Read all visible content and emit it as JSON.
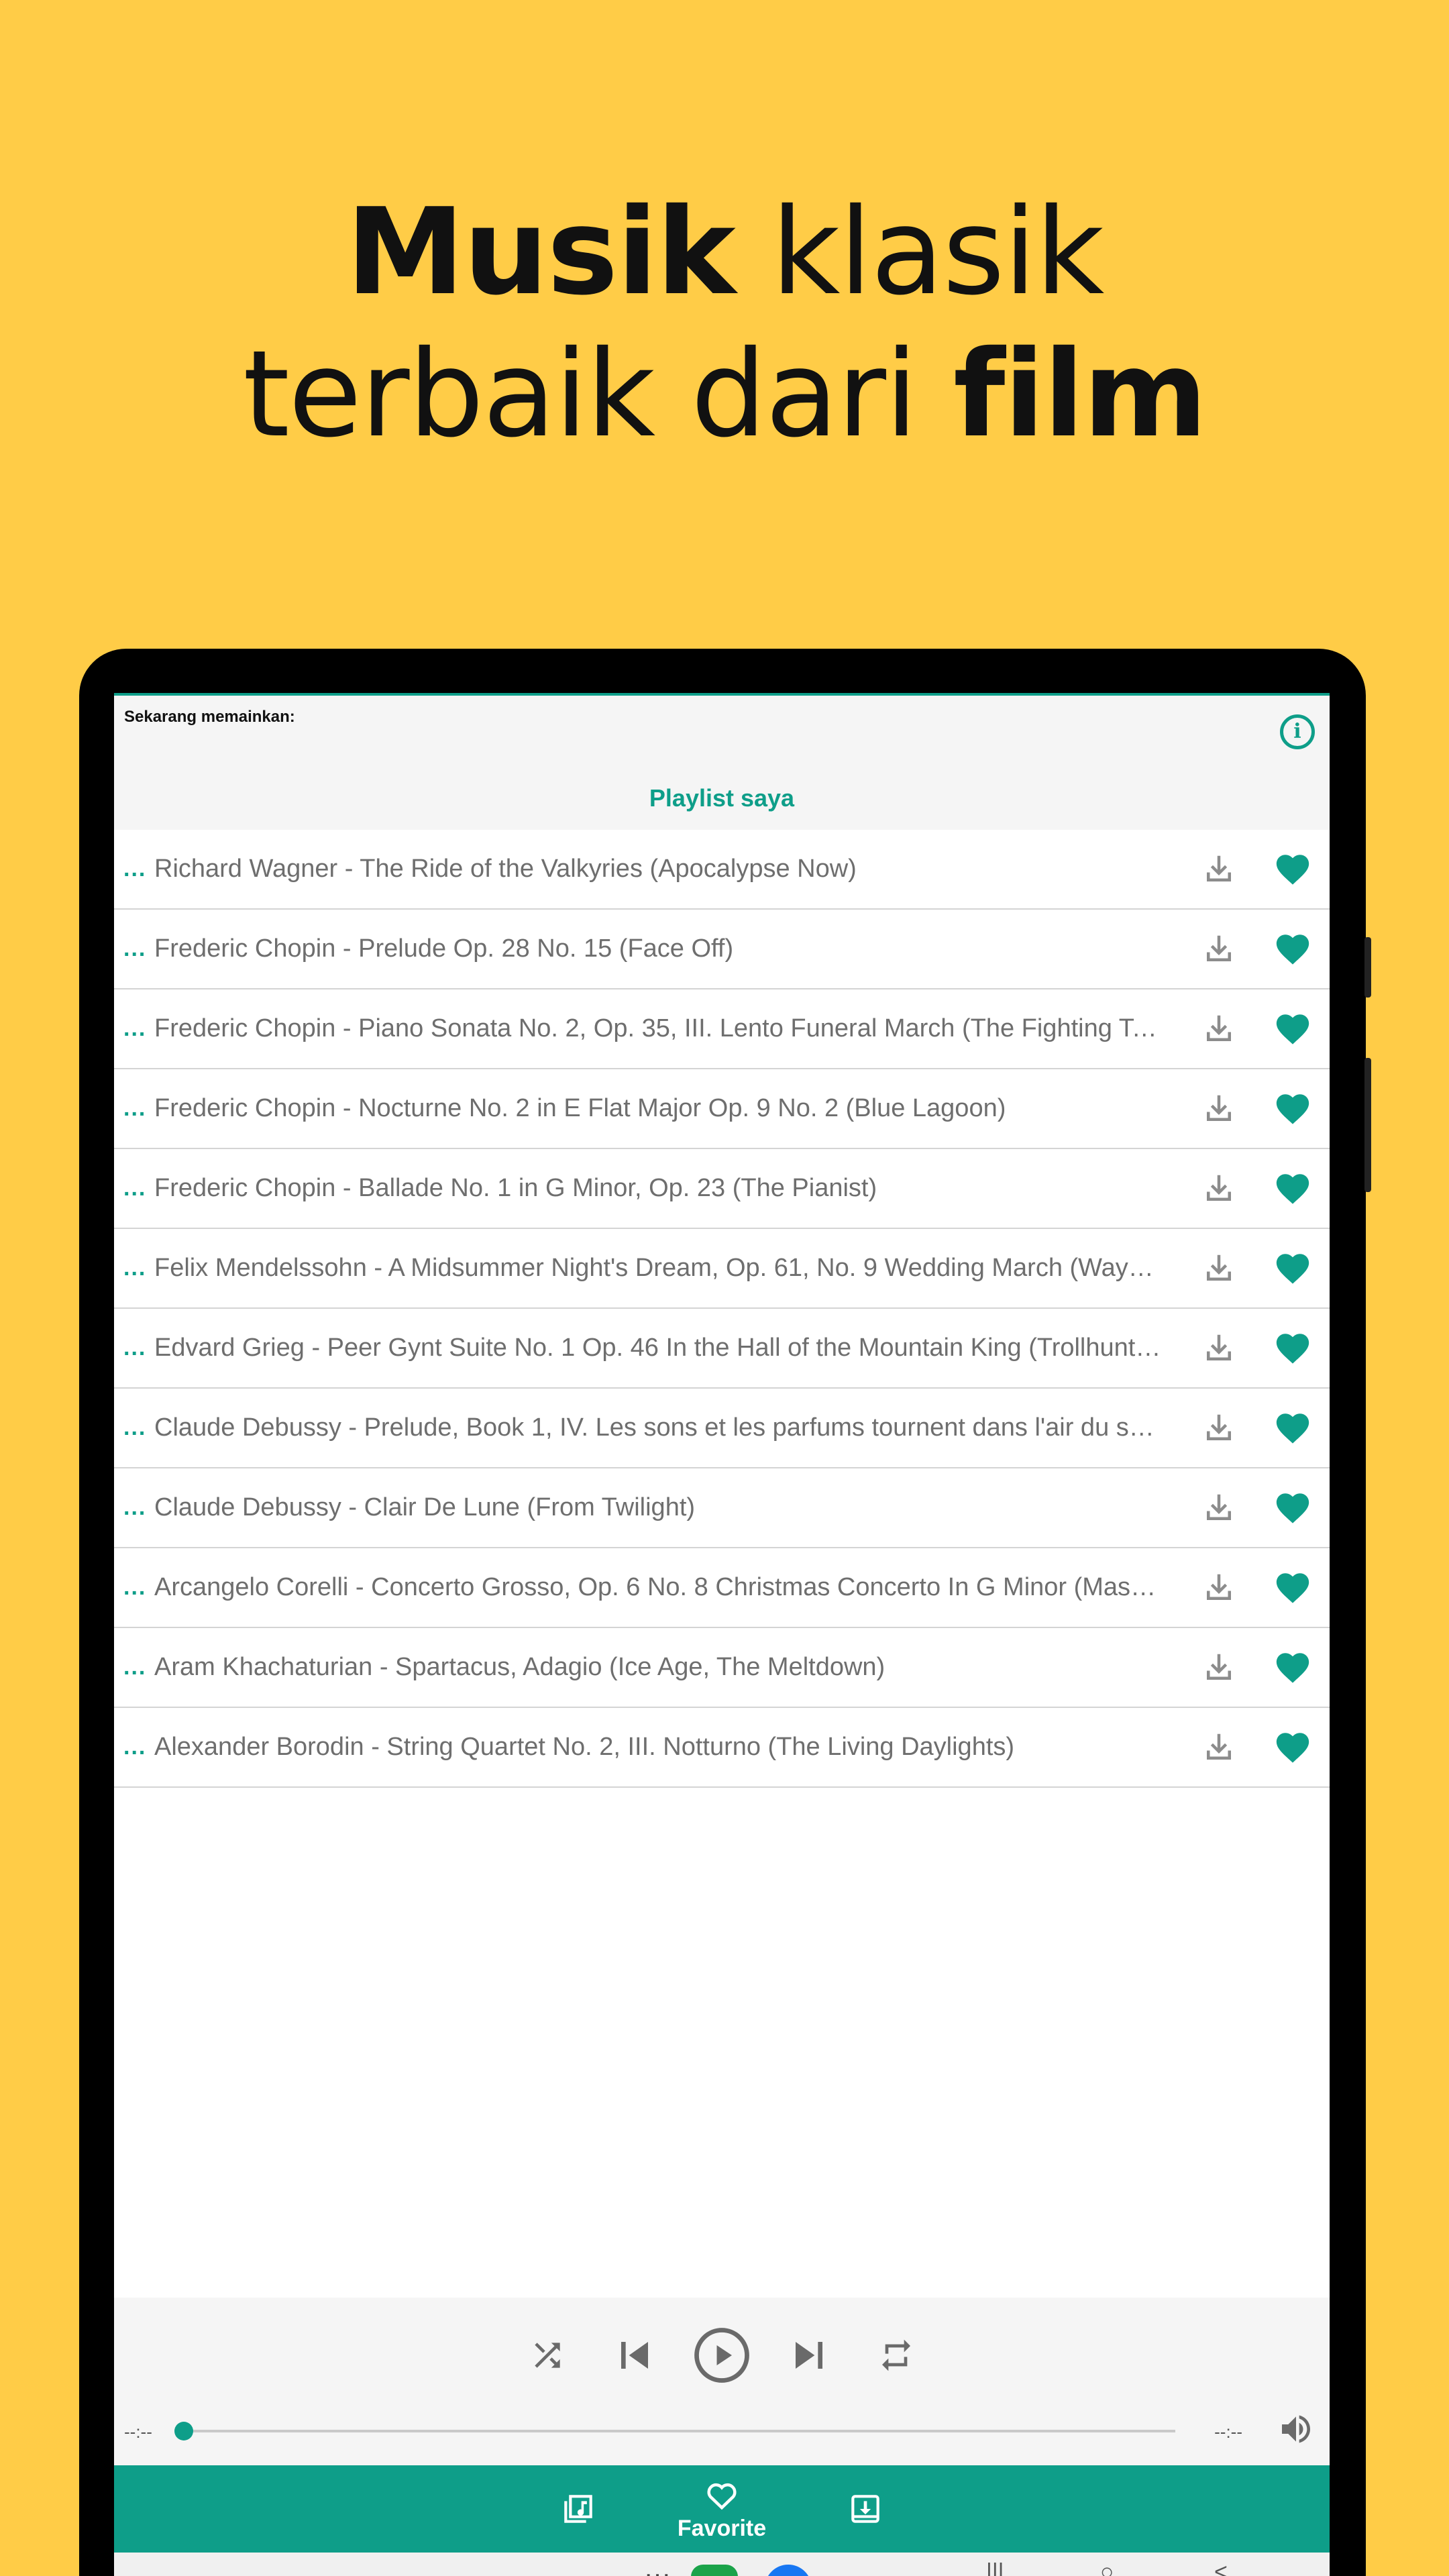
{
  "headline": {
    "line1_bold": "Musik",
    "line1_rest": " klasik",
    "line2_rest": "terbaik dari ",
    "line2_bold": "film"
  },
  "app": {
    "now_playing_label": "Sekarang memainkan:",
    "playlist_title": "Playlist saya",
    "accent_color": "#0E9E89",
    "tracks": [
      {
        "dots": "...",
        "title": "Richard Wagner - The Ride of the Valkyries (Apocalypse Now)"
      },
      {
        "dots": "...",
        "title": "Frederic Chopin - Prelude Op. 28 No. 15 (Face Off)"
      },
      {
        "dots": "...",
        "title": "Frederic Chopin - Piano Sonata No. 2, Op. 35, III. Lento Funeral March (The Fighting Tempt.."
      },
      {
        "dots": "...",
        "title": "Frederic Chopin - Nocturne No. 2 in E Flat Major Op. 9 No. 2 (Blue Lagoon)"
      },
      {
        "dots": "...",
        "title": "Frederic Chopin - Ballade No. 1 in G Minor, Op. 23 (The Pianist)"
      },
      {
        "dots": "...",
        "title": "Felix Mendelssohn - A Midsummer Night's Dream, Op. 61, No. 9 Wedding March (Wayne's.."
      },
      {
        "dots": "...",
        "title": "Edvard Grieg - Peer Gynt Suite No. 1 Op. 46 In the Hall of the Mountain King (Trollhunter)"
      },
      {
        "dots": "...",
        "title": "Claude Debussy - Prelude, Book 1, IV. Les sons et les parfums tournent dans l'air du soir (T.."
      },
      {
        "dots": "...",
        "title": "Claude Debussy - Clair De Lune (From Twilight)"
      },
      {
        "dots": "...",
        "title": "Arcangelo Corelli - Concerto Grosso, Op. 6 No. 8 Christmas Concerto In G Minor (Master an.."
      },
      {
        "dots": "...",
        "title": "Aram Khachaturian - Spartacus, Adagio (Ice Age, The Meltdown)"
      },
      {
        "dots": "...",
        "title": "Alexander Borodin - String Quartet No. 2, III. Notturno (The Living Daylights)"
      }
    ],
    "player": {
      "time_elapsed": "--:--",
      "time_total": "--:--",
      "progress": 0
    },
    "nav": {
      "favorite_label": "Favorite"
    },
    "sysbar": {
      "dots": "···",
      "app1_letter": "f",
      "recent": "|||",
      "home": "○",
      "back": "<"
    }
  }
}
